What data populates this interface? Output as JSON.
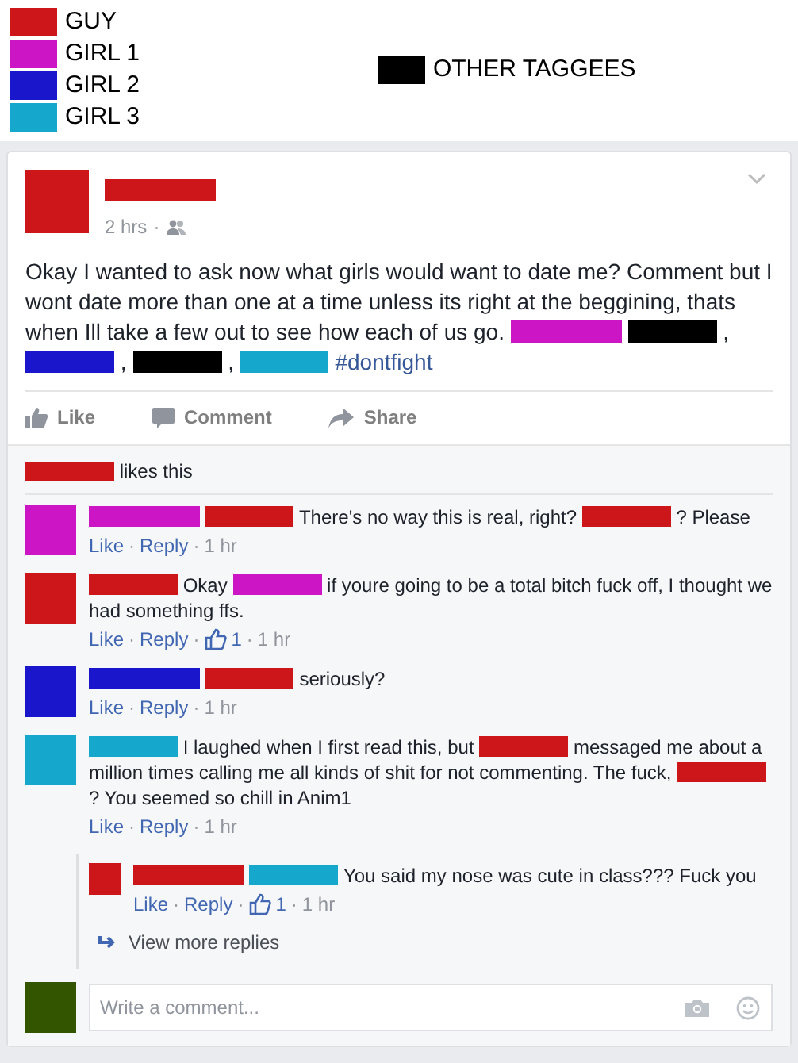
{
  "legend": {
    "items": [
      {
        "label": "GUY",
        "color": "#cc1619"
      },
      {
        "label": "GIRL 1",
        "color": "#cc16c6"
      },
      {
        "label": "GIRL 2",
        "color": "#1a16cc"
      },
      {
        "label": "GIRL 3",
        "color": "#16a8cc"
      }
    ],
    "other": {
      "label": "OTHER TAGGEES",
      "color": "#000000"
    }
  },
  "separator": "·",
  "post": {
    "avatar": {
      "color": "#cc1619"
    },
    "author": {
      "color": "#cc1619"
    },
    "time": "2 hrs",
    "body": [
      {
        "kind": "text",
        "text": "Okay I wanted to ask now what girls would want to date me? Comment but I wont date more than one at a time unless its right at the beggining, thats when Ill take a few out to see how each of us go."
      },
      {
        "kind": "bar",
        "color": "#cc16c6"
      },
      {
        "kind": "bar",
        "color": "#000000"
      },
      {
        "kind": "text",
        "text": ","
      },
      {
        "kind": "bar",
        "color": "#1a16cc"
      },
      {
        "kind": "text",
        "text": ","
      },
      {
        "kind": "bar",
        "color": "#000000"
      },
      {
        "kind": "text",
        "text": ","
      },
      {
        "kind": "bar",
        "color": "#16a8cc"
      },
      {
        "kind": "link",
        "text": "#dontfight"
      }
    ],
    "actions": [
      {
        "kind": "like",
        "label": "Like"
      },
      {
        "kind": "comment",
        "label": "Comment"
      },
      {
        "kind": "share",
        "label": "Share"
      }
    ],
    "likes": [
      {
        "kind": "bar",
        "color": "#cc1619"
      },
      {
        "kind": "text",
        "text": "likes this"
      }
    ]
  },
  "comments": [
    {
      "avatar": {
        "color": "#cc16c6"
      },
      "body": [
        {
          "kind": "bar",
          "color": "#cc16c6"
        },
        {
          "kind": "bar",
          "color": "#cc1619"
        },
        {
          "kind": "text",
          "text": "There's no way this is real, right?"
        },
        {
          "kind": "bar",
          "color": "#cc1619"
        },
        {
          "kind": "text",
          "text": "? Please"
        }
      ],
      "like": "Like",
      "reply": "Reply",
      "time": "1 hr"
    },
    {
      "avatar": {
        "color": "#cc1619"
      },
      "body": [
        {
          "kind": "bar",
          "color": "#cc1619"
        },
        {
          "kind": "text",
          "text": "Okay"
        },
        {
          "kind": "bar",
          "color": "#cc16c6"
        },
        {
          "kind": "text",
          "text": "if youre going to be a total bitch fuck off, I thought we had something ffs."
        }
      ],
      "like": "Like",
      "reply": "Reply",
      "likes": "1",
      "time": "1 hr"
    },
    {
      "avatar": {
        "color": "#1a16cc"
      },
      "body": [
        {
          "kind": "bar",
          "color": "#1a16cc"
        },
        {
          "kind": "bar",
          "color": "#cc1619"
        },
        {
          "kind": "text",
          "text": "seriously?"
        }
      ],
      "like": "Like",
      "reply": "Reply",
      "time": "1 hr"
    },
    {
      "avatar": {
        "color": "#16a8cc"
      },
      "body": [
        {
          "kind": "bar",
          "color": "#16a8cc"
        },
        {
          "kind": "text",
          "text": "I laughed when I first read this, but"
        },
        {
          "kind": "bar",
          "color": "#cc1619"
        },
        {
          "kind": "text",
          "text": "messaged me about a million times calling me all kinds of shit for not commenting. The fuck,"
        },
        {
          "kind": "bar",
          "color": "#cc1619"
        },
        {
          "kind": "text",
          "text": "? You seemed so chill in Anim1"
        }
      ],
      "like": "Like",
      "reply": "Reply",
      "time": "1 hr",
      "replies": [
        {
          "avatar": {
            "color": "#cc1619"
          },
          "body": [
            {
              "kind": "bar",
              "color": "#cc1619"
            },
            {
              "kind": "bar",
              "color": "#16a8cc"
            },
            {
              "kind": "text",
              "text": "You said my nose was cute in class??? Fuck you"
            }
          ],
          "like": "Like",
          "reply": "Reply",
          "likes": "1",
          "time": "1 hr"
        }
      ],
      "view_more": "View more replies"
    }
  ],
  "composer": {
    "avatar": {
      "color": "#335500"
    },
    "placeholder": "Write a comment..."
  }
}
